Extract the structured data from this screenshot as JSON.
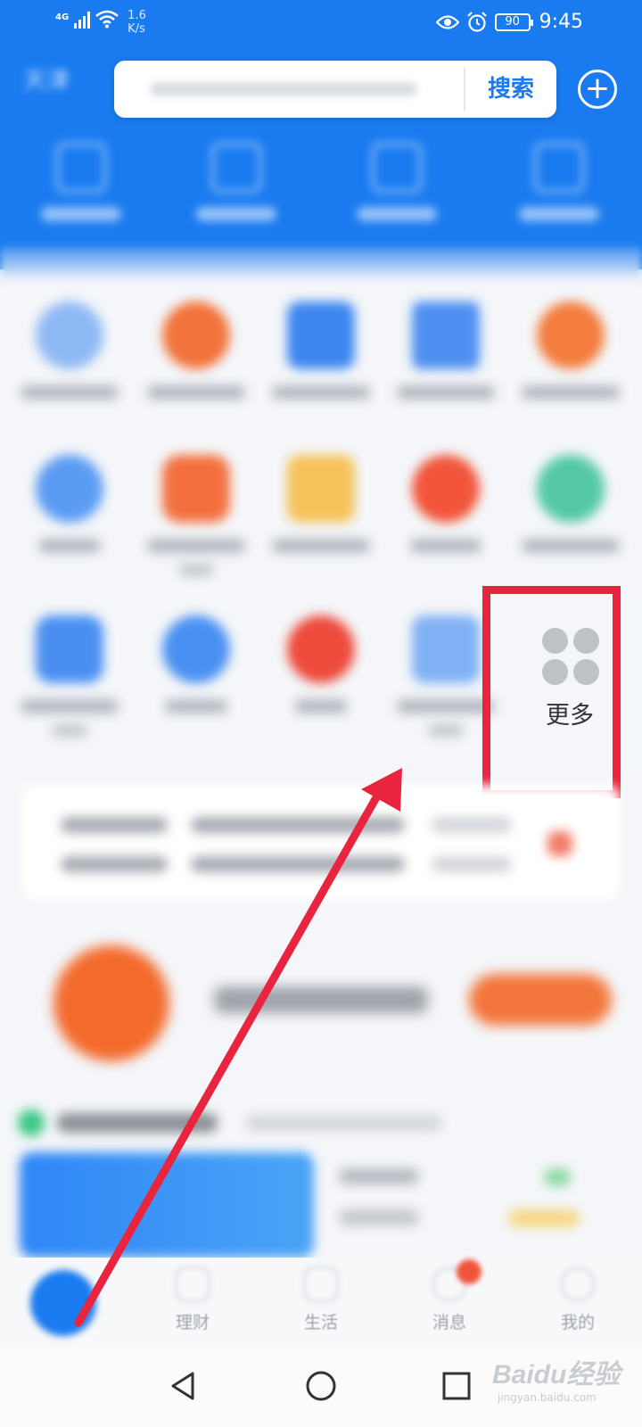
{
  "status_bar": {
    "network": "4G",
    "speed_value": "1.6",
    "speed_unit": "K/s",
    "battery": "90",
    "time": "9:45"
  },
  "header": {
    "city": "天津",
    "search_button": "搜索",
    "add_icon": "plus-circle-icon"
  },
  "grid": {
    "more_label": "更多",
    "more_icon": "four-dots-icon"
  },
  "bottom_nav": {
    "items": [
      {
        "label": "",
        "icon": "home-icon"
      },
      {
        "label": "理财",
        "icon": "wealth-icon"
      },
      {
        "label": "生活",
        "icon": "life-icon"
      },
      {
        "label": "消息",
        "icon": "message-icon"
      },
      {
        "label": "我的",
        "icon": "profile-icon"
      }
    ]
  },
  "system_nav": {
    "back_icon": "back-triangle-icon",
    "home_icon": "home-circle-icon",
    "recents_icon": "recents-square-icon"
  },
  "watermark": {
    "brand": "Baidu经验",
    "url": "jingyan.baidu.com"
  },
  "colors": {
    "brand_blue": "#1a7bf0",
    "highlight_red": "#e8243f",
    "arrow_red": "#e8243f"
  }
}
